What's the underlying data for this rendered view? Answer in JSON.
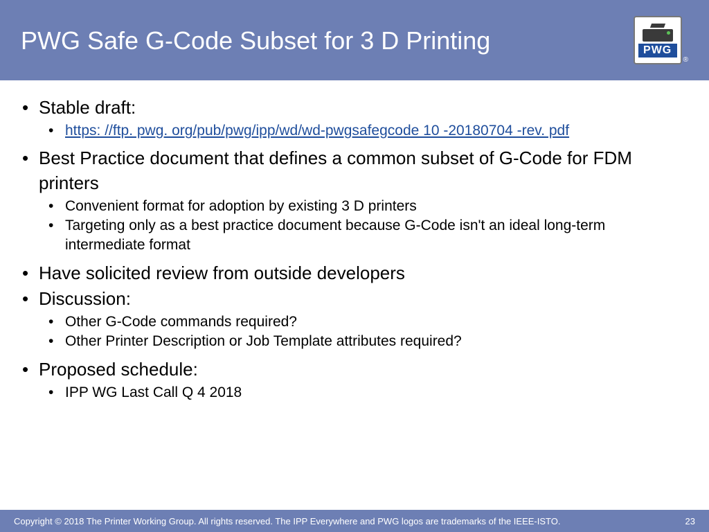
{
  "header": {
    "title": "PWG Safe G-Code Subset for 3 D Printing",
    "logo_text": "PWG",
    "registered": "®"
  },
  "bullets": {
    "b1": "Stable draft:",
    "b1_sub1_link": "https: //ftp. pwg. org/pub/pwg/ipp/wd/wd-pwgsafegcode 10 -20180704 -rev. pdf",
    "b2": "Best Practice document that defines a common subset of G-Code for FDM printers",
    "b2_sub1": "Convenient format for adoption by existing 3 D printers",
    "b2_sub2": "Targeting only as a best practice document because G-Code isn't an ideal long-term intermediate format",
    "b3": "Have solicited review from outside developers",
    "b4": "Discussion:",
    "b4_sub1": "Other G-Code commands required?",
    "b4_sub2": "Other Printer Description or Job Template attributes required?",
    "b5": "Proposed schedule:",
    "b5_sub1": "IPP WG Last Call Q 4 2018"
  },
  "footer": {
    "copyright": "Copyright © 2018 The Printer Working Group. All rights reserved. The IPP Everywhere and PWG logos are trademarks of the IEEE-ISTO.",
    "page": "23"
  }
}
